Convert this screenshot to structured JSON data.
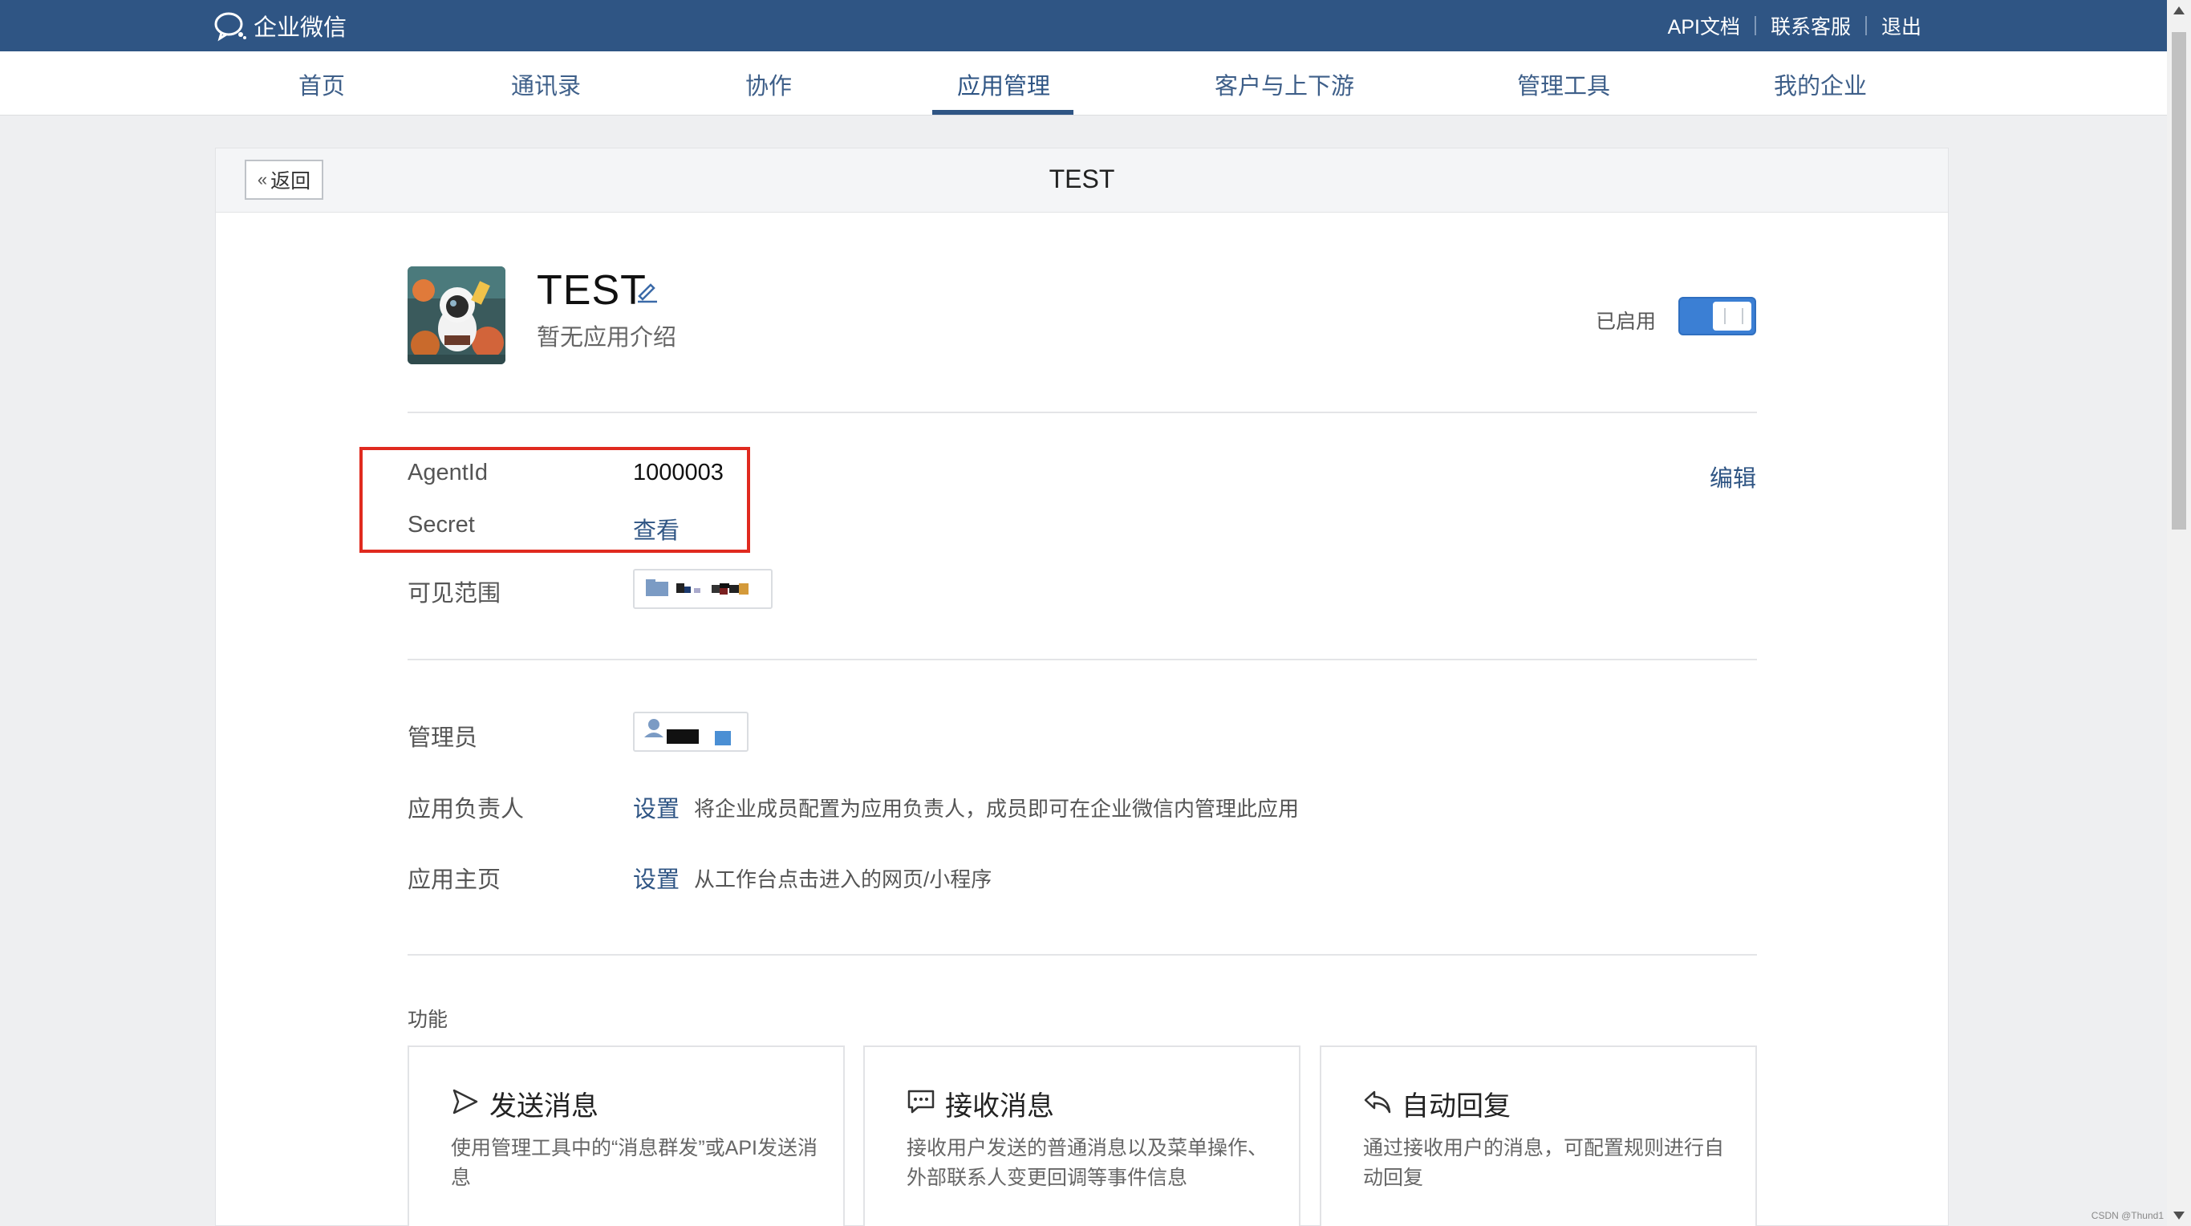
{
  "topbar": {
    "logo_text": "企业微信",
    "links": [
      "API文档",
      "联系客服",
      "退出"
    ],
    "color": "#2f5584"
  },
  "nav": {
    "items": [
      "首页",
      "通讯录",
      "协作",
      "应用管理",
      "客户与上下游",
      "管理工具",
      "我的企业"
    ],
    "active": "应用管理"
  },
  "header": {
    "back_label": "返回",
    "title": "TEST"
  },
  "app": {
    "name": "TEST",
    "description": "暂无应用介绍",
    "status_label": "已启用",
    "enabled": true
  },
  "fields": {
    "agent_id_label": "AgentId",
    "agent_id_value": "1000003",
    "secret_label": "Secret",
    "secret_action": "查看",
    "edit_label": "编辑",
    "visible_range_label": "可见范围",
    "admin_label": "管理员",
    "owner_label": "应用负责人",
    "owner_action": "设置",
    "owner_hint": "将企业成员配置为应用负责人，成员即可在企业微信内管理此应用",
    "homepage_label": "应用主页",
    "homepage_action": "设置",
    "homepage_hint": "从工作台点击进入的网页/小程序"
  },
  "features": {
    "section_title": "功能",
    "cards": [
      {
        "title": "发送消息",
        "desc": "使用管理工具中的“消息群发”或API发送消息",
        "icon": "send-icon"
      },
      {
        "title": "接收消息",
        "desc": "接收用户发送的普通消息以及菜单操作、外部联系人变更回调等事件信息",
        "icon": "chat-bubble-icon"
      },
      {
        "title": "自动回复",
        "desc": "通过接收用户的消息，可配置规则进行自动回复",
        "icon": "reply-icon"
      }
    ]
  },
  "watermark": "CSDN @Thund1"
}
